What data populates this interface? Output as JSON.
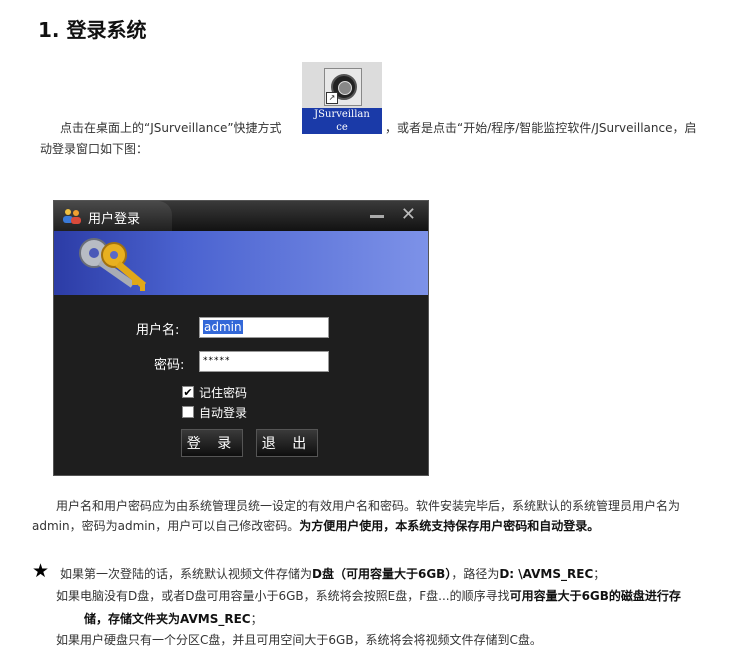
{
  "heading": "1. 登录系统",
  "shortcut": {
    "label_line1": "JSurveillan",
    "label_line2": "ce"
  },
  "intro": {
    "part1": "点击在桌面上的“JSurveillance”快捷方式",
    "part2": "，或者是点击“开始/程序/智能监控软件/JSurveillance，启",
    "part3": "动登录窗口如下图："
  },
  "dialog": {
    "title": "用户登录",
    "minimize_glyph": "—",
    "close_glyph": "✕",
    "username_label": "用户名:",
    "username_value": "admin",
    "password_label": "密码:",
    "password_value": "*****",
    "remember_label": "记住密码",
    "remember_checked": "✔",
    "auto_login_label": "自动登录",
    "login_button": "登 录",
    "exit_button": "退 出"
  },
  "para2": {
    "line1": "用户名和用户密码应为由系统管理员统一设定的有效用户名和密码。软件安装完毕后，系统默认的系统管理员用户名为",
    "line2_normal": "admin，密码为admin，用户可以自己修改密码。",
    "line2_bold": "为方便用户使用，本系统支持保存用户密码和自动登录。"
  },
  "note": {
    "star": "★",
    "l1_a": "如果第一次登陆的话，系统默认视频文件存储为",
    "l1_b": "D盘（可用容量大于6GB）",
    "l1_c": "，路径为",
    "l1_d": "D: \\AVMS_REC",
    "l1_e": "；",
    "l2_a": "如果电脑没有D盘，或者D盘可用容量小于6GB，系统将会按照E盘，F盘...的顺序寻找",
    "l2_b": "可用容量大于6GB的磁盘进行存",
    "l3_a": "储，存储文件夹为AVMS_REC",
    "l3_b": "；",
    "l4_a": "如果用户硬盘只有一个分区C盘，并且可用空间大于6GB，系统将会将视频文件存储到C盘。"
  }
}
